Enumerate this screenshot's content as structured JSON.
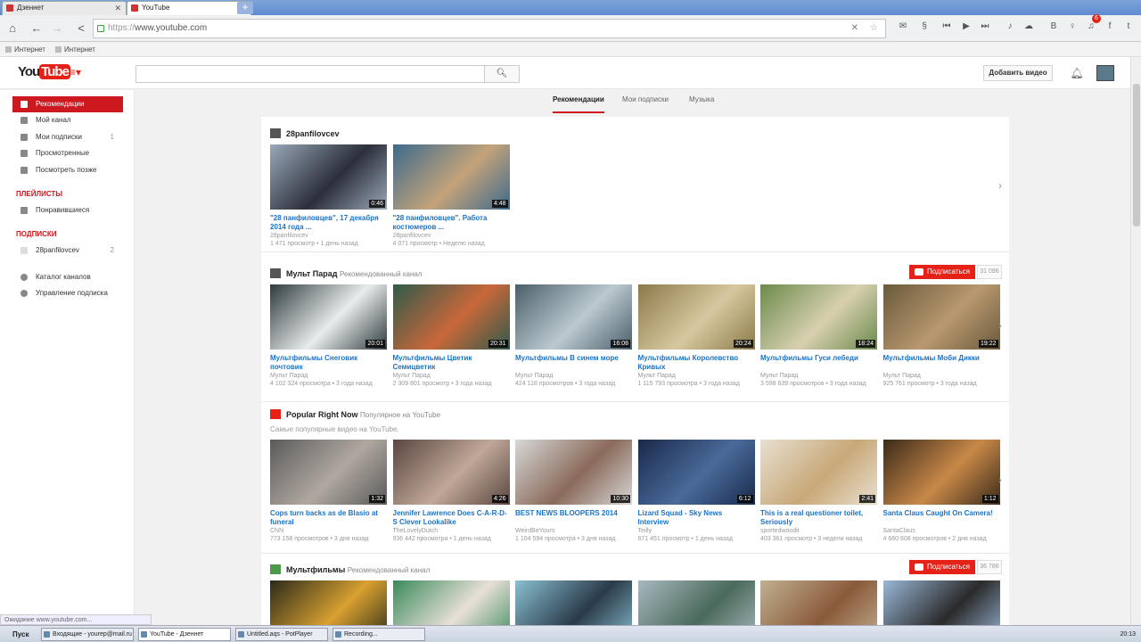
{
  "browser": {
    "tabs": [
      {
        "label": "Дзеннет"
      },
      {
        "label": "YouTube"
      }
    ],
    "url_proto": "https://",
    "url_host": "www.youtube.com",
    "bookmarks": [
      {
        "label": "Интернет"
      },
      {
        "label": "Интернет"
      }
    ],
    "notification_count": "6"
  },
  "masthead": {
    "logo_you": "You",
    "logo_tube": "Tube",
    "search_placeholder": "",
    "upload_label": "Добавить видео"
  },
  "sidebar": {
    "items": [
      {
        "label": "Рекомендации"
      },
      {
        "label": "Мой канал"
      },
      {
        "label": "Мои подписки",
        "count": "1"
      },
      {
        "label": "Просмотренные"
      },
      {
        "label": "Посмотреть позже"
      }
    ],
    "playlists_header": "ПЛЕЙЛИСТЫ",
    "playlists": [
      {
        "label": "Понравившиеся"
      }
    ],
    "subscriptions_header": "ПОДПИСКИ",
    "subscriptions": [
      {
        "label": "28panfilovcev",
        "count": "2"
      }
    ],
    "bottom": [
      {
        "label": "Каталог каналов"
      },
      {
        "label": "Управление подписка"
      }
    ]
  },
  "feed_tabs": [
    {
      "label": "Рекомендации"
    },
    {
      "label": "Мои подписки"
    },
    {
      "label": "Музыка"
    }
  ],
  "shelves": [
    {
      "title": "28panfilovcev",
      "subtitle": "",
      "videos": [
        {
          "title": "\"28 панфиловцев\", 17 декабря 2014 года ...",
          "channel": "28panfilovcev",
          "meta": "1 471 просмотр • 1 день назад",
          "duration": "0:46",
          "colors": [
            "#9aa8b8",
            "#2b2f3a"
          ]
        },
        {
          "title": "\"28 панфиловцев\". Работа костюмеров ...",
          "channel": "28panfilovcev",
          "meta": "4 071 просмотр • Неделю назад",
          "duration": "4:48",
          "colors": [
            "#3d6a8c",
            "#c4a37a"
          ]
        }
      ]
    },
    {
      "title": "Мульт Парад",
      "subtitle": "Рекомендованный канал",
      "subscribe_label": "Подписаться",
      "subscribe_count": "31 096",
      "videos": [
        {
          "title": "Мультфильмы Снеговик почтовик",
          "channel": "Мульт Парад",
          "meta": "4 102 324 просмотра • 3 года назад",
          "duration": "20:01",
          "colors": [
            "#2e3a3c",
            "#e8ecec"
          ]
        },
        {
          "title": "Мультфильмы Цветик Семицветик",
          "channel": "Мульт Парад",
          "meta": "2 309 801 просмотр • 3 года назад",
          "duration": "20:31",
          "colors": [
            "#2f5a4a",
            "#c9683a"
          ]
        },
        {
          "title": "Мультфильмы В синем море",
          "channel": "Мульт Парад",
          "meta": "424 118 просмотров • 3 года назад",
          "duration": "16:08",
          "colors": [
            "#4a5f6a",
            "#bcc9d0"
          ]
        },
        {
          "title": "Мультфильмы Королевство Кривых",
          "channel": "Мульт Парад",
          "meta": "1 115 793 просмотра • 3 года назад",
          "duration": "20:24",
          "colors": [
            "#8a7a4a",
            "#d8c8a0"
          ]
        },
        {
          "title": "Мультфильмы Гуси лебеди",
          "channel": "Мульт Парад",
          "meta": "3 598 639 просмотров • 3 года назад",
          "duration": "18:24",
          "colors": [
            "#6a8a4a",
            "#d8d0b0"
          ]
        },
        {
          "title": "Мультфильмы Моби Дикки",
          "channel": "Мульт Парад",
          "meta": "925 761 просмотр • 3 года назад",
          "duration": "19:22",
          "colors": [
            "#6a5a3a",
            "#b89870"
          ]
        }
      ]
    },
    {
      "title": "Popular Right Now",
      "subtitle": "Популярное на YouTube",
      "description": "Самые популярные видео на YouTube.",
      "videos": [
        {
          "title": "Cops turn backs as de Blasio at funeral",
          "channel": "CNN",
          "meta": "773 158 просмотров • 3 дня назад",
          "duration": "1:32",
          "colors": [
            "#5a5a5a",
            "#b0a8a0"
          ]
        },
        {
          "title": "Jennifer Lawrence Does C-A-R-D-S Clever Lookalike",
          "channel": "TheLovelyDutch",
          "meta": "936 442 просмотра • 1 день назад",
          "duration": "4:26",
          "colors": [
            "#5a4640",
            "#c0a898"
          ]
        },
        {
          "title": "BEST NEWS BLOOPERS 2014",
          "channel": "WeirdBeYours",
          "meta": "1 104 594 просмотра • 3 дня назад",
          "duration": "10:30",
          "colors": [
            "#d8d8d8",
            "#8a6a5a"
          ]
        },
        {
          "title": "Lizard Squad - Sky News Interview",
          "channel": "Teilly",
          "meta": "671 451 просмотр • 1 день назад",
          "duration": "6:12",
          "colors": [
            "#1a2a4a",
            "#4a6a9a"
          ]
        },
        {
          "title": "This is a real questioner toilet, Seriously",
          "channel": "sportedwoodit",
          "meta": "403 361 просмотр • 3 недели назад",
          "duration": "2:41",
          "colors": [
            "#e8e0d0",
            "#c8a878"
          ]
        },
        {
          "title": "Santa Claus Caught On Camera!",
          "channel": "SantaClaus",
          "meta": "4 660 608 просмотров • 2 дня назад",
          "duration": "1:12",
          "colors": [
            "#3a2a1a",
            "#c88848"
          ]
        }
      ]
    },
    {
      "title": "Мультфильмы",
      "subtitle": "Рекомендованный канал",
      "subscribe_label": "Подписаться",
      "subscribe_count": "36 786",
      "videos": [
        {
          "colors": [
            "#2a2a1a",
            "#d8a030"
          ]
        },
        {
          "colors": [
            "#3a8a5a",
            "#e8e0d8"
          ]
        },
        {
          "colors": [
            "#8ac0d0",
            "#2a3a4a"
          ]
        },
        {
          "colors": [
            "#a8b8c0",
            "#4a6a5a"
          ]
        },
        {
          "colors": [
            "#c0b090",
            "#8a5a3a"
          ]
        },
        {
          "colors": [
            "#9ab8d8",
            "#2a2a2a"
          ]
        }
      ]
    }
  ],
  "statusbar": "Ожидание www.youtube.com...",
  "taskbar": {
    "start": "Пуск",
    "items": [
      {
        "label": "Входящие - yourep@mail.ru"
      },
      {
        "label": "YouTube - Дзеннет"
      },
      {
        "label": "Untitled.aqs - PotPlayer"
      },
      {
        "label": "Recording..."
      }
    ],
    "clock": "20:13"
  }
}
